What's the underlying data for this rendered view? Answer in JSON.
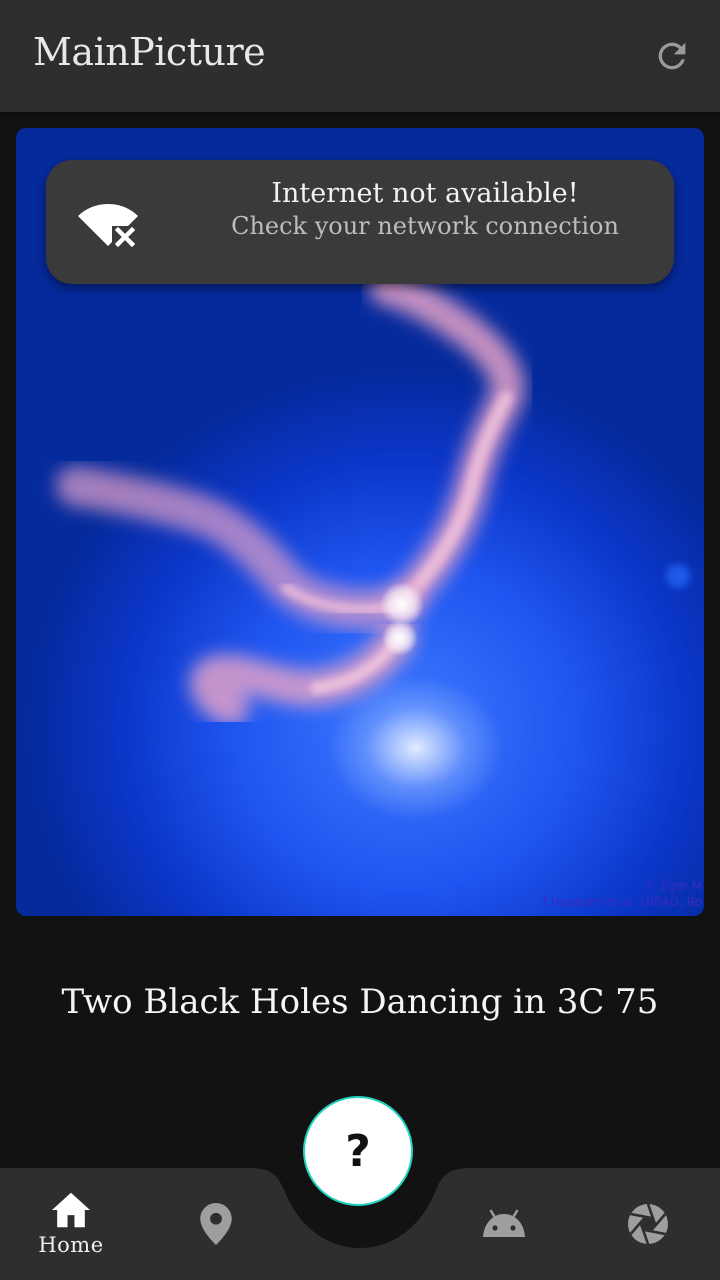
{
  "appbar": {
    "title": "MainPicture",
    "refresh_icon": "refresh-icon"
  },
  "snackbar": {
    "icon": "wifi-off-icon",
    "title": "Internet not available!",
    "message": "Check your network connection"
  },
  "picture": {
    "credit_line1": "© Egor M",
    "credit_line2": "T.Hepburn et al. (NRAO, Ro"
  },
  "caption": "Two Black Holes Dancing in 3C 75",
  "fab": {
    "label": "?",
    "border_color": "#1fd3c0"
  },
  "bottom_nav": {
    "items": [
      {
        "icon": "home-icon",
        "label": "Home",
        "active": true
      },
      {
        "icon": "location-pin-icon",
        "label": "",
        "active": false
      },
      {
        "icon": "android-icon",
        "label": "",
        "active": false
      },
      {
        "icon": "camera-aperture-icon",
        "label": "",
        "active": false
      }
    ]
  },
  "colors": {
    "background": "#121212",
    "appbar": "#2e2e2e",
    "snackbar": "#3a3a3a",
    "icon_gray": "#9e9e9e"
  }
}
